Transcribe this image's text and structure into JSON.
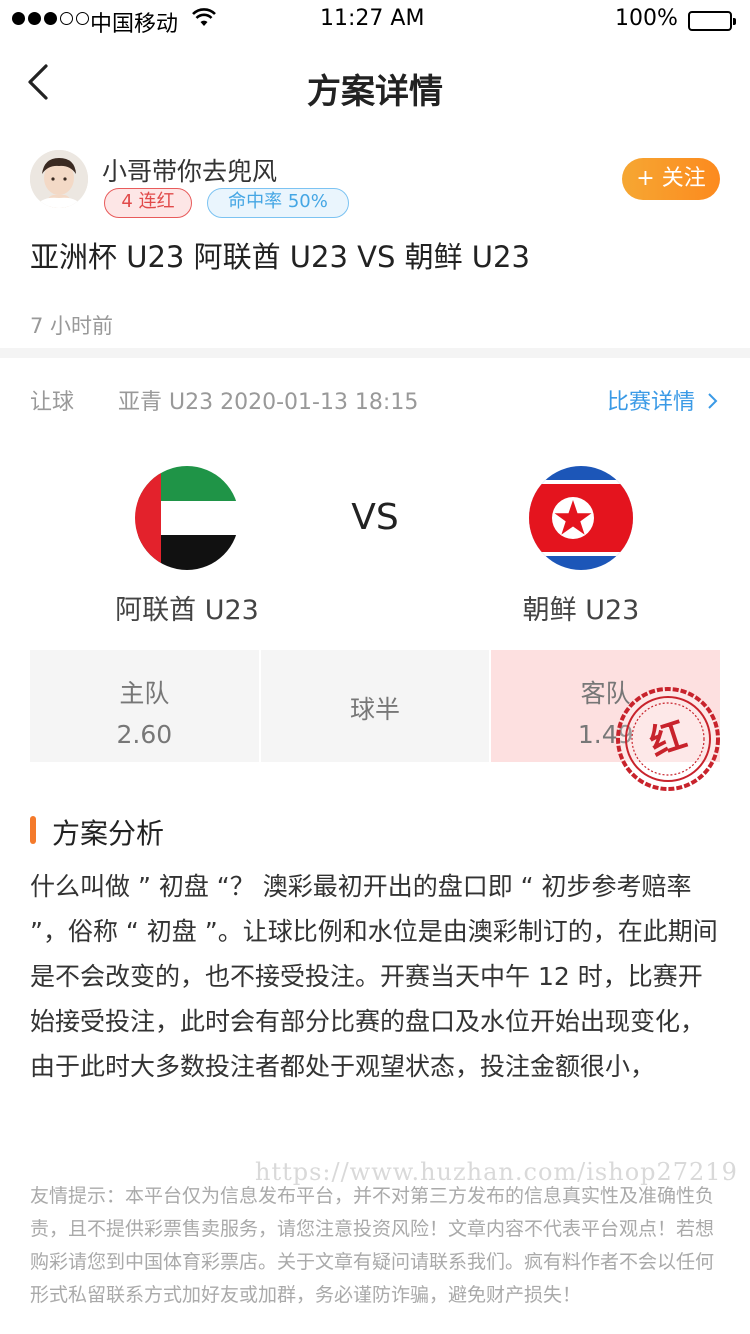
{
  "status": {
    "carrier": "中国移动",
    "time": "11:27 AM",
    "battery": "100%"
  },
  "nav": {
    "title": "方案详情"
  },
  "author": {
    "name": "小哥带你去兜风",
    "streak_badge": "4 连红",
    "hit_rate_badge": "命中率 50%",
    "follow_label": "+ 关注"
  },
  "match": {
    "title": "亚洲杯 U23 阿联酋 U23 VS 朝鲜 U23",
    "posted": "7 小时前",
    "bet_type": "让球",
    "league_time": "亚青 U23 2020-01-13 18:15",
    "detail_link": "比赛详情",
    "home_team": "阿联酋 U23",
    "away_team": "朝鲜 U23",
    "vs": "VS"
  },
  "odds": {
    "home_label": "主队",
    "home_value": "2.60",
    "handicap": "球半",
    "away_label": "客队",
    "away_value": "1.49",
    "result_stamp": "红"
  },
  "analysis": {
    "heading": "方案分析",
    "body": "什么叫做 ” 初盘 “？ 澳彩最初开出的盘口即 “ 初步参考赔率 ”，俗称 “ 初盘 ”。让球比例和水位是由澳彩制订的，在此期间是不会改变的，也不接受投注。开赛当天中午 12 时，比赛开始接受投注，此时会有部分比赛的盘口及水位开始出现变化，由于此时大多数投注者都处于观望状态，投注金额很小，"
  },
  "watermark": "https://www.huzhan.com/ishop27219",
  "disclaimer": "友情提示：本平台仅为信息发布平台，并不对第三方发布的信息真实性及准确性负责，且不提供彩票售卖服务，请您注意投资风险！文章内容不代表平台观点！若想购彩请您到中国体育彩票店。关于文章有疑问请联系我们。疯有料作者不会以任何形式私留联系方式加好友或加群，务必谨防诈骗，避免财产损失！",
  "colors": {
    "accent_orange": "#f47a2b",
    "link_blue": "#3a9ae6",
    "hit_red": "#fde0e0",
    "stamp_red": "#c8232c"
  },
  "icons": [
    "signal-icon",
    "wifi-icon",
    "battery-icon",
    "back-arrow-icon",
    "chevron-right-icon",
    "uae-flag-icon",
    "north-korea-flag-icon",
    "red-stamp-icon"
  ]
}
